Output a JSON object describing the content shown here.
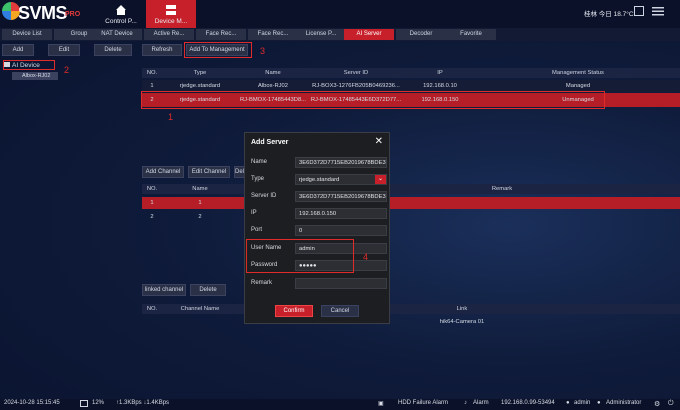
{
  "app": {
    "logo": "SVMS",
    "logo_sub": "PRO"
  },
  "nav": [
    {
      "label": "Control P...",
      "icon": "home-icon",
      "active": false
    },
    {
      "label": "Device M...",
      "icon": "device-icon",
      "active": true
    }
  ],
  "header_right": {
    "weather": "桂林 今日 18.7°C"
  },
  "subtabs": [
    "Device List",
    "Group",
    "NAT Device",
    "Active Re...",
    "Face Rec...",
    "Face Rec...",
    "License P...",
    "AI Server",
    "Decoder",
    "Favorite"
  ],
  "left_toolbar": {
    "add": "Add",
    "edit": "Edit",
    "delete": "Delete"
  },
  "tree": {
    "root": "AI Device",
    "child": "Albox-RJ02"
  },
  "server_toolbar": {
    "refresh": "Refresh",
    "add_to_mgmt": "Add To Management"
  },
  "server_table": {
    "headers": [
      "NO.",
      "Type",
      "Name",
      "Server ID",
      "IP",
      "Management Status"
    ],
    "rows": [
      [
        "1",
        "rjedge.standard",
        "Albox-RJ02",
        "RJ-BOX3-1276FB205B0469236...",
        "192.168.0.10",
        "Managed"
      ],
      [
        "2",
        "rjedge.standard",
        "RJ-BMOX-17485443D8...",
        "RJ-BMOX-17485443E6D372D77...",
        "192.168.0.150",
        "Unmanaged"
      ]
    ]
  },
  "channel_toolbar": {
    "add": "Add Channel",
    "edit": "Edit Channel",
    "delete": "Dele"
  },
  "channel_table": {
    "headers": [
      "NO.",
      "Name",
      "Remark"
    ],
    "rows": [
      [
        "1",
        "1",
        ""
      ],
      [
        "2",
        "2",
        ""
      ]
    ]
  },
  "linked_toolbar": {
    "linked": "linked channel",
    "delete": "Delete"
  },
  "linked_table": {
    "headers": [
      "NO.",
      "Channel Name",
      "Link"
    ],
    "rows": [
      [
        "",
        "",
        "hik64-Camera 01"
      ]
    ]
  },
  "dialog": {
    "title": "Add Server",
    "name_label": "Name",
    "name_value": "3E6D372D7715EB2019678BDE3",
    "type_label": "Type",
    "type_value": "rjedge.standard",
    "server_id_label": "Server ID",
    "server_id_value": "3E6D372D7715EB2019678BDE3",
    "ip_label": "IP",
    "ip_value": "192.168.0.150",
    "port_label": "Port",
    "port_value": "0",
    "user_label": "User Name",
    "user_value": "admin",
    "pass_label": "Password",
    "pass_value": "●●●●●",
    "remark_label": "Remark",
    "remark_value": "",
    "confirm": "Confirm",
    "cancel": "Cancel"
  },
  "annotations": [
    "1",
    "2",
    "3",
    "4"
  ],
  "status": {
    "datetime": "2024-10-28 15:15:45",
    "cpu": "12%",
    "net": "↑1.3KBps ↓1.4KBps",
    "alarm1": "HDD Failure Alarm",
    "alarm2": "Alarm",
    "server": "192.168.0.99-53494",
    "user1": "admin",
    "user2": "Administrator"
  },
  "colors": {
    "accent": "#c8202a",
    "annotation": "#e02b2b",
    "background": "#0f1b3a"
  }
}
